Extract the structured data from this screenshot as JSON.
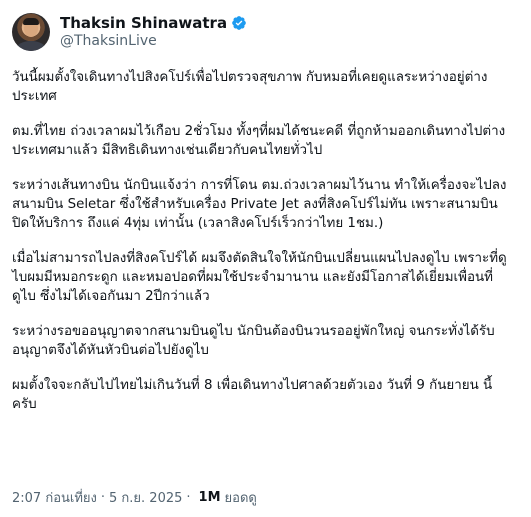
{
  "author": {
    "display_name": "Thaksin Shinawatra",
    "handle": "@ThaksinLive",
    "verified_color": "#1d9bf0"
  },
  "post": {
    "paragraphs": [
      "วันนี้ผมตั้งใจเดินทางไปสิงคโปร์เพื่อไปตรวจสุขภาพ กับหมอที่เคยดูแลระหว่างอยู่ต่างประเทศ",
      "ตม.ที่ไทย ถ่วงเวลาผมไว้เกือบ 2ชั่วโมง ทั้งๆที่ผมได้ชนะคดี ที่ถูกห้ามออกเดินทางไปต่างประเทศมาแล้ว มีสิทธิเดินทางเช่นเดียวกับคนไทยทั่วไป",
      "ระหว่างเส้นทางบิน นักบินแจ้งว่า การที่โดน ตม.ถ่วงเวลาผมไว้นาน ทำให้เครื่องจะไปลงสนามบิน Seletar ซึ่งใช้สำหรับเครื่อง Private Jet ลงที่สิงคโปร์ไม่ทัน เพราะสนามบินปิดให้บริการ ถึงแค่ 4ทุ่ม เท่านั้น (เวลาสิงคโปร์เร็วกว่าไทย 1ชม.)",
      "เมื่อไม่สามารถไปลงที่สิงคโปร์ได้  ผมจึงตัดสินใจให้นักบินเปลี่ยนแผนไปลงดูไบ เพราะที่ดูไบผมมีหมอกระดูก และหมอปอดที่ผมใช้ประจำมานาน และยังมีโอกาสได้เยี่ยมเพื่อนที่ดูไบ ซึ่งไม่ได้เจอกันมา 2ปีกว่าแล้ว",
      "ระหว่างรอขออนุญาตจากสนามบินดูไบ นักบินต้องบินวนรออยู่พักใหญ่ จนกระทั่งได้รับอนุญาตจึงได้หันหัวบินต่อไปยังดูไบ",
      "ผมตั้งใจจะกลับไปไทยไม่เกินวันที่ 8 เพื่อเดินทางไปศาลด้วยตัวเอง วันที่ 9 กันยายน นี้ ครับ"
    ]
  },
  "meta": {
    "time": "2:07 ก่อนเที่ยง",
    "separator": "·",
    "date": "5 ก.ย. 2025",
    "views_count": "1M",
    "views_label": "ยอดดู"
  }
}
